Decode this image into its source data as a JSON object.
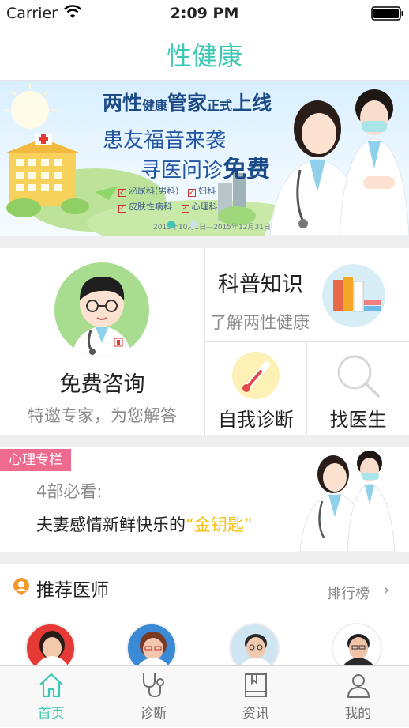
{
  "status": {
    "carrier": "Carrier",
    "time": "2:09 PM"
  },
  "header": {
    "title": "性健康"
  },
  "banner": {
    "headline_a": "两性",
    "headline_b": "健康",
    "headline_c": "管家",
    "headline_d": "正式",
    "headline_e": "上线",
    "line1": "患友福音来袭",
    "line2": "寻医问诊",
    "line2_emph": "免费",
    "checks": [
      "泌尿科(男科)",
      "妇科",
      "皮肤性病科",
      "心理科"
    ],
    "date_text": "2015年10月1日—2015年12月31日"
  },
  "features": {
    "consult": {
      "title": "免费咨询",
      "subtitle": "特邀专家，为您解答"
    },
    "science": {
      "title": "科普知识",
      "subtitle": "了解两性健康"
    },
    "self_diag": {
      "title": "自我诊断"
    },
    "find_doctor": {
      "title": "找医生"
    }
  },
  "psych": {
    "tag": "心理专栏",
    "line1": "4部必看:",
    "line2_prefix": "夫妻感情新鲜快乐的",
    "line2_highlight": "“金钥匙”"
  },
  "doctors": {
    "title": "推荐医师",
    "ranking": "排行榜"
  },
  "tabbar": {
    "items": [
      {
        "label": "首页",
        "icon": "home-icon",
        "active": true
      },
      {
        "label": "诊断",
        "icon": "stethoscope-icon",
        "active": false
      },
      {
        "label": "资讯",
        "icon": "book-icon",
        "active": false
      },
      {
        "label": "我的",
        "icon": "person-icon",
        "active": false
      }
    ]
  },
  "colors": {
    "accent": "#3cc8b4",
    "pink_tag": "#ee6b8f",
    "highlight": "#f2c21b",
    "tab_active": "#3cc8b4",
    "tab_inactive": "#6f6f6f"
  }
}
